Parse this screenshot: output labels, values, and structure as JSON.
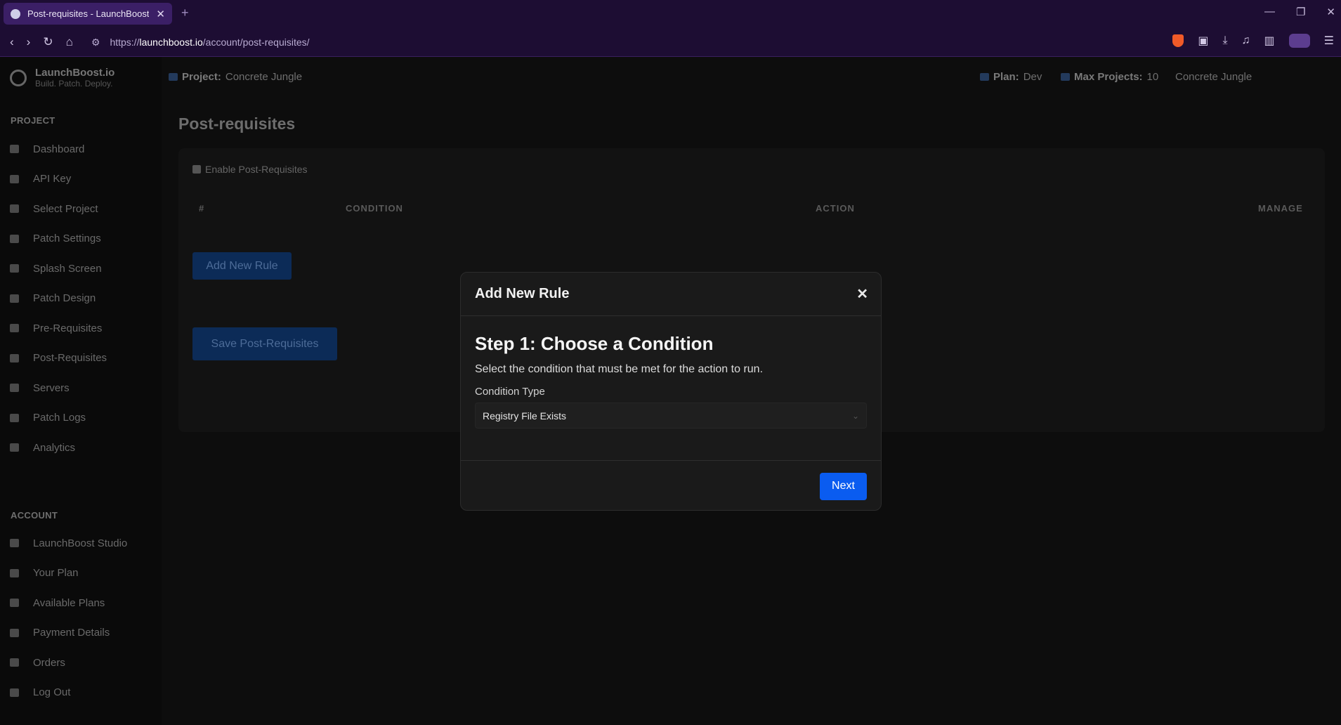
{
  "browser": {
    "tab_title": "Post-requisites - LaunchBoost",
    "new_tab": "+",
    "url_prefix": "https://",
    "url_host": "launchboost.io",
    "url_path": "/account/post-requisites/"
  },
  "brand": {
    "name": "LaunchBoost.io",
    "tagline": "Build. Patch. Deploy."
  },
  "sidebar": {
    "project_heading": "PROJECT",
    "project_items": [
      {
        "label": "Dashboard"
      },
      {
        "label": "API Key"
      },
      {
        "label": "Select Project"
      },
      {
        "label": "Patch Settings"
      },
      {
        "label": "Splash Screen"
      },
      {
        "label": "Patch Design"
      },
      {
        "label": "Pre-Requisites"
      },
      {
        "label": "Post-Requisites"
      },
      {
        "label": "Servers"
      },
      {
        "label": "Patch Logs"
      },
      {
        "label": "Analytics"
      }
    ],
    "account_heading": "ACCOUNT",
    "account_items": [
      {
        "label": "LaunchBoost Studio"
      },
      {
        "label": "Your Plan"
      },
      {
        "label": "Available Plans"
      },
      {
        "label": "Payment Details"
      },
      {
        "label": "Orders"
      },
      {
        "label": "Log Out"
      }
    ]
  },
  "header": {
    "project_label": "Project:",
    "project_value": "Concrete Jungle",
    "plan_label": "Plan:",
    "plan_value": "Dev",
    "max_label": "Max Projects:",
    "max_value": "10",
    "user": "Concrete Jungle"
  },
  "page": {
    "title": "Post-requisites",
    "enable_label": "Enable Post-Requisites",
    "col_num": "#",
    "col_condition": "CONDITION",
    "col_action": "ACTION",
    "col_manage": "MANAGE",
    "add_rule": "Add New Rule",
    "save": "Save Post-Requisites"
  },
  "modal": {
    "title": "Add New Rule",
    "step": "Step 1: Choose a Condition",
    "description": "Select the condition that must be met for the action to run.",
    "condition_label": "Condition Type",
    "condition_value": "Registry File Exists",
    "next": "Next"
  }
}
